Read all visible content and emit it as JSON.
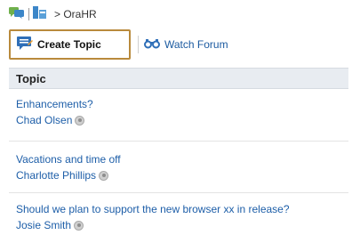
{
  "breadcrumb": {
    "text": "> OraHR"
  },
  "toolbar": {
    "create_label": "Create Topic",
    "watch_label": "Watch Forum"
  },
  "table": {
    "header": "Topic",
    "rows": [
      {
        "title": "Enhancements?",
        "author": "Chad Olsen"
      },
      {
        "title": "Vacations and time off",
        "author": "Charlotte Phillips"
      },
      {
        "title": "Should we plan to support the new browser xx in release?",
        "author": "Josie Smith"
      }
    ]
  },
  "colors": {
    "link": "#1d5ea8",
    "highlight_border": "#b98a3c",
    "header_bg": "#e8ecf1"
  }
}
